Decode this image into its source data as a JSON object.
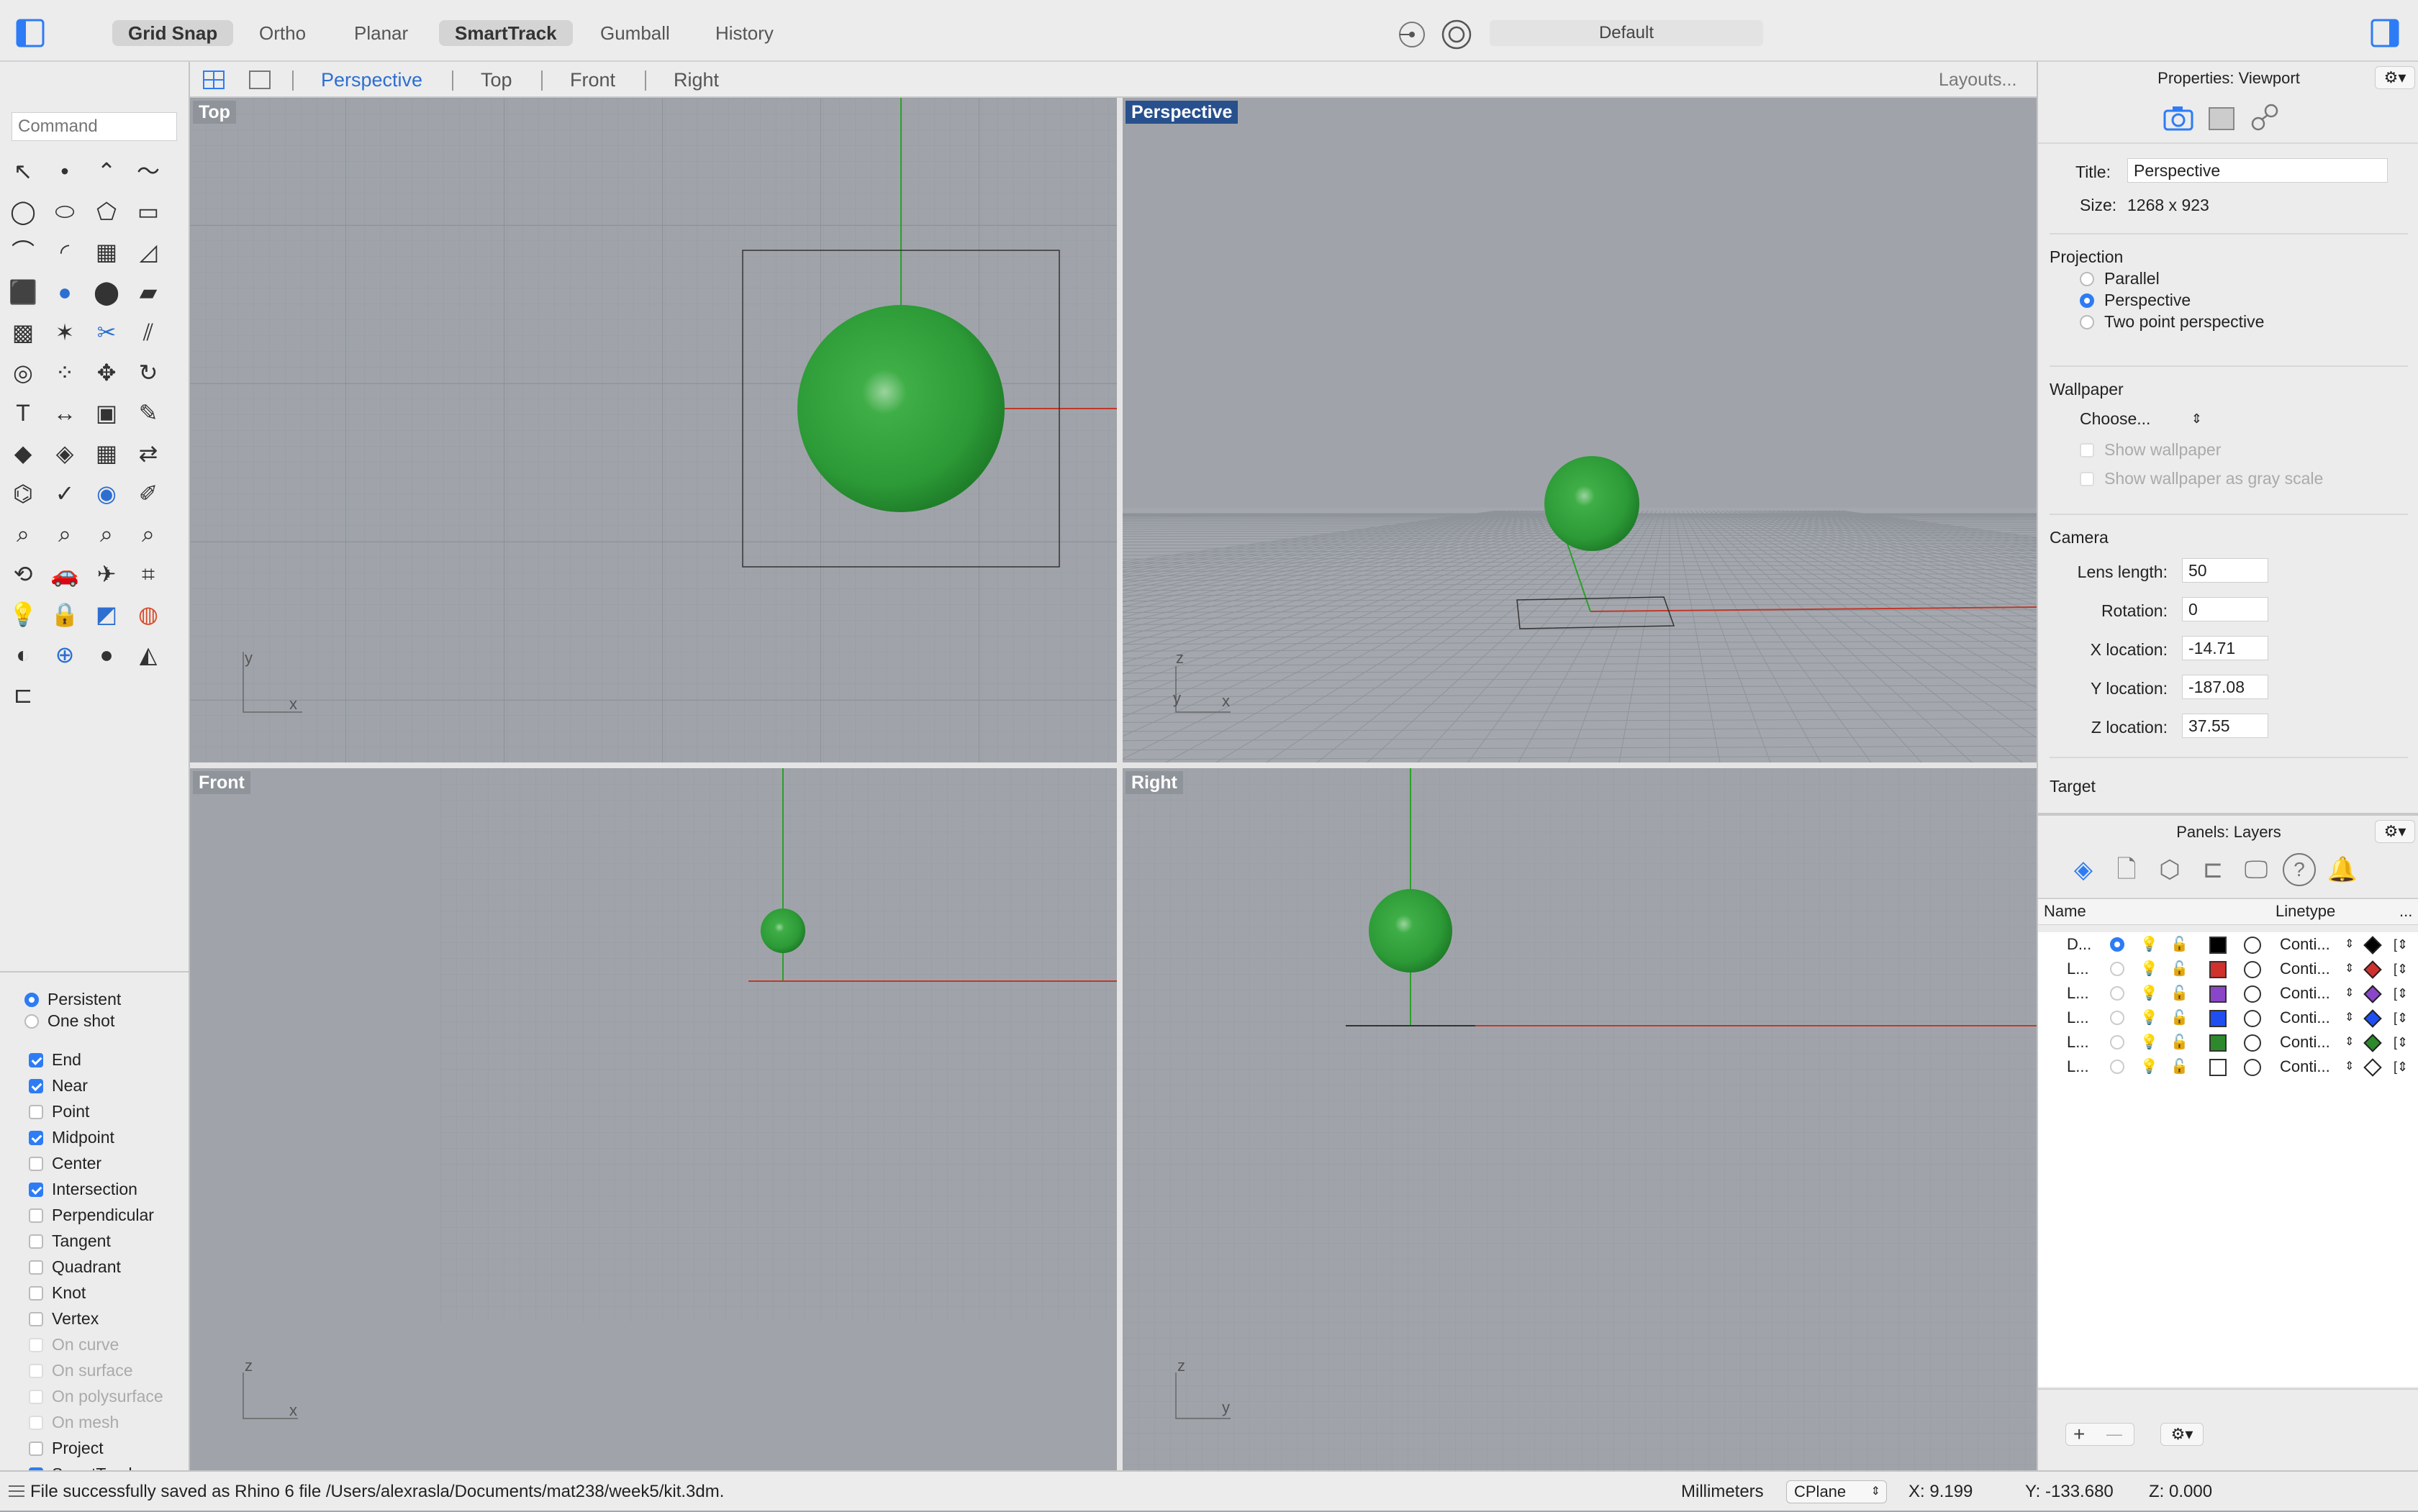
{
  "toolbar": {
    "toggles": [
      "Grid Snap",
      "Ortho",
      "Planar",
      "SmartTrack",
      "Gumball",
      "History"
    ],
    "active_toggles": [
      "Grid Snap",
      "SmartTrack"
    ],
    "layer_value": "Default"
  },
  "viewport_tabs": {
    "tabs": [
      "Perspective",
      "Top",
      "Front",
      "Right"
    ],
    "active": "Perspective",
    "layouts_label": "Layouts..."
  },
  "command": {
    "placeholder": "Command"
  },
  "osnap": {
    "modes": [
      {
        "label": "Persistent",
        "type": "radio",
        "checked": true
      },
      {
        "label": "One shot",
        "type": "radio",
        "checked": false
      }
    ],
    "items": [
      {
        "label": "End",
        "checked": true,
        "enabled": true
      },
      {
        "label": "Near",
        "checked": true,
        "enabled": true
      },
      {
        "label": "Point",
        "checked": false,
        "enabled": true
      },
      {
        "label": "Midpoint",
        "checked": true,
        "enabled": true
      },
      {
        "label": "Center",
        "checked": false,
        "enabled": true
      },
      {
        "label": "Intersection",
        "checked": true,
        "enabled": true
      },
      {
        "label": "Perpendicular",
        "checked": false,
        "enabled": true
      },
      {
        "label": "Tangent",
        "checked": false,
        "enabled": true
      },
      {
        "label": "Quadrant",
        "checked": false,
        "enabled": true
      },
      {
        "label": "Knot",
        "checked": false,
        "enabled": true
      },
      {
        "label": "Vertex",
        "checked": false,
        "enabled": true
      },
      {
        "label": "On curve",
        "checked": false,
        "enabled": false
      },
      {
        "label": "On surface",
        "checked": false,
        "enabled": false
      },
      {
        "label": "On polysurface",
        "checked": false,
        "enabled": false
      },
      {
        "label": "On mesh",
        "checked": false,
        "enabled": false
      },
      {
        "label": "Project",
        "checked": false,
        "enabled": true
      },
      {
        "label": "SmartTrack",
        "checked": true,
        "enabled": true
      }
    ]
  },
  "viewports": {
    "top": {
      "label": "Top",
      "axis_a": "y",
      "axis_b": "x"
    },
    "perspective": {
      "label": "Perspective",
      "axis_a": "z",
      "axis_b": "y",
      "axis_c": "x"
    },
    "front": {
      "label": "Front",
      "axis_a": "z",
      "axis_b": "x"
    },
    "right": {
      "label": "Right",
      "axis_a": "z",
      "axis_b": "y"
    }
  },
  "properties": {
    "header": "Properties: Viewport",
    "title_label": "Title:",
    "title_value": "Perspective",
    "size_label": "Size:",
    "size_value": "1268 x 923",
    "projection_label": "Projection",
    "projection_options": [
      {
        "label": "Parallel",
        "checked": false
      },
      {
        "label": "Perspective",
        "checked": true
      },
      {
        "label": "Two point perspective",
        "checked": false
      }
    ],
    "wallpaper_label": "Wallpaper",
    "wallpaper_choose": "Choose...",
    "show_wallpaper": "Show wallpaper",
    "show_wallpaper_gray": "Show wallpaper as gray scale",
    "camera_label": "Camera",
    "camera_fields": [
      {
        "label": "Lens length:",
        "value": "50"
      },
      {
        "label": "Rotation:",
        "value": "0"
      },
      {
        "label": "X location:",
        "value": "-14.71"
      },
      {
        "label": "Y location:",
        "value": "-187.08"
      },
      {
        "label": "Z location:",
        "value": "37.55"
      }
    ],
    "target_label": "Target"
  },
  "layers": {
    "header": "Panels: Layers",
    "col_name": "Name",
    "col_linetype": "Linetype",
    "col_more": "...",
    "rows": [
      {
        "name": "D...",
        "current": true,
        "color": "#000000",
        "linetype": "Conti...",
        "print_color": "#000000"
      },
      {
        "name": "L...",
        "current": false,
        "color": "#d0312d",
        "linetype": "Conti...",
        "print_color": "#d0312d"
      },
      {
        "name": "L...",
        "current": false,
        "color": "#8a46c8",
        "linetype": "Conti...",
        "print_color": "#8a46c8"
      },
      {
        "name": "L...",
        "current": false,
        "color": "#1f4ff0",
        "linetype": "Conti...",
        "print_color": "#1f4ff0"
      },
      {
        "name": "L...",
        "current": false,
        "color": "#2c8a2c",
        "linetype": "Conti...",
        "print_color": "#2c8a2c"
      },
      {
        "name": "L...",
        "current": false,
        "color": "#ffffff",
        "linetype": "Conti...",
        "print_color": "#ffffff"
      }
    ],
    "add_label": "+",
    "remove_label": "—"
  },
  "status": {
    "message": "File successfully saved as Rhino 6 file /Users/alexrasla/Documents/mat238/week5/kit.3dm.",
    "units": "Millimeters",
    "cplane": "CPlane",
    "x": "X: 9.199",
    "y": "Y: -133.680",
    "z": "Z: 0.000"
  },
  "colors": {
    "accent": "#2d7cf6",
    "active_viewport": "#27508d",
    "sphere": "#2f9e3a",
    "x_axis": "#c0392b",
    "y_axis": "#2aa02a"
  }
}
